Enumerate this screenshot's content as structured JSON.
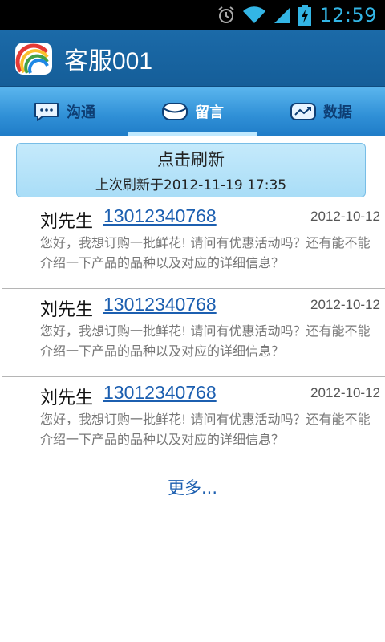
{
  "status_bar": {
    "time": "12:59",
    "icons": [
      "alarm-icon",
      "wifi-icon",
      "signal-icon",
      "battery-charging-icon"
    ]
  },
  "header": {
    "title": "客服001",
    "logo": "rainbow-logo-icon"
  },
  "tabs": [
    {
      "label": "沟通",
      "icon": "chat-bubble-icon",
      "active": false
    },
    {
      "label": "留言",
      "icon": "message-icon",
      "active": true
    },
    {
      "label": "数据",
      "icon": "trend-chart-icon",
      "active": false
    }
  ],
  "refresh": {
    "title": "点击刷新",
    "last_refresh": "上次刷新于2012-11-19  17:35"
  },
  "messages": [
    {
      "name": "刘先生",
      "phone": "13012340768",
      "date": "2012-10-12",
      "line1": "您好，我想订购一批鲜花! 请问有优惠活动吗？还有能不能",
      "line2": "介绍一下产品的品种以及对应的详细信息？"
    },
    {
      "name": "刘先生",
      "phone": "13012340768",
      "date": "2012-10-12",
      "line1": "您好，我想订购一批鲜花! 请问有优惠活动吗？还有能不能",
      "line2": "介绍一下产品的品种以及对应的详细信息？"
    },
    {
      "name": "刘先生",
      "phone": "13012340768",
      "date": "2012-10-12",
      "line1": "您好，我想订购一批鲜花! 请问有优惠活动吗？还有能不能",
      "line2": "介绍一下产品的品种以及对应的详细信息？"
    }
  ],
  "more_label": "更多...",
  "colors": {
    "header_bg": "#1b6aa8",
    "tab_bg": "#2f8fd6",
    "link": "#1c5fb0",
    "clock": "#33b5e5"
  }
}
